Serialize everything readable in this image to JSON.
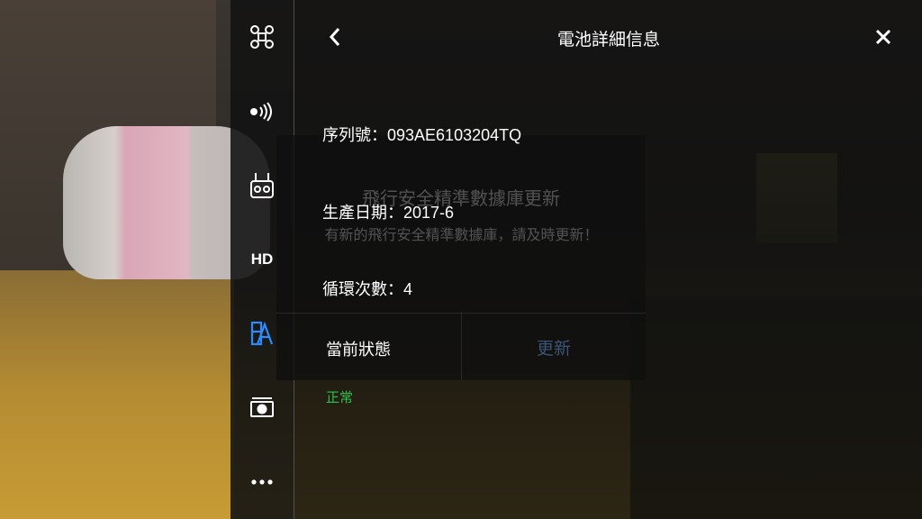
{
  "sidebar": {
    "items": [
      {
        "icon": "drone-icon"
      },
      {
        "icon": "signal-icon"
      },
      {
        "icon": "remote-controller-icon"
      },
      {
        "icon": "hd-icon",
        "label": "HD"
      },
      {
        "icon": "battery-info-icon",
        "active": true
      },
      {
        "icon": "camera-icon"
      },
      {
        "icon": "more-icon"
      }
    ],
    "active_color": "#2a8cff"
  },
  "header": {
    "title": "電池詳細信息",
    "back_icon": "chevron-left-icon",
    "close_icon": "close-icon"
  },
  "background_dialog": {
    "title": "飛行安全精準數據庫更新",
    "body": "有新的飛行安全精準數據庫，請及時更新！",
    "button": "更新"
  },
  "battery_details": {
    "serial_label": "序列號：",
    "serial_value": "093AE6103204TQ",
    "production_date_label": "生產日期：",
    "production_date_value": "2017-6",
    "cycle_count_label": "循環次數：",
    "cycle_count_value": "4",
    "status_label": "當前狀態",
    "status_value": "正常",
    "status_color": "#2ec24a"
  }
}
